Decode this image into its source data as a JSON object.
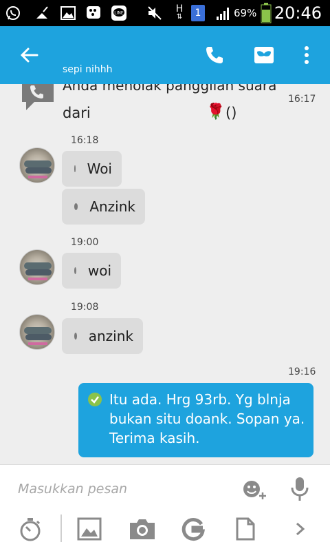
{
  "status_bar": {
    "battery_percent": "69%",
    "clock": "20:46",
    "sim_badge": "1",
    "network_label": "H",
    "icons": [
      "whatsapp-icon",
      "broom-icon",
      "gallery-icon",
      "bbm-icon",
      "line-icon",
      "mute-icon",
      "network-h-icon",
      "sim-icon",
      "signal-icon",
      "battery-icon"
    ]
  },
  "app_bar": {
    "subtitle": "sepi nihhh",
    "icons": [
      "back-arrow-icon",
      "phone-icon",
      "mask-icon",
      "overflow-menu-icon"
    ]
  },
  "messages": {
    "system": {
      "line1": "Anda menolak panggilan suara",
      "line2": "dari",
      "emoji": "🌹",
      "paren": "()",
      "time": "16:17"
    },
    "group1_time": "16:18",
    "msg1": "Woi",
    "msg2": "Anzink",
    "group2_time": "19:00",
    "msg3": "woi",
    "group3_time": "19:08",
    "msg4": "anzink",
    "out_time": "19:16",
    "out_msg": "Itu ada. Hrg 93rb. Yg blnja bukan situ doank. Sopan ya. Terima kasih."
  },
  "input": {
    "placeholder": "Masukkan pesan",
    "icons": [
      "emoji-add-icon",
      "mic-icon"
    ]
  },
  "toolbar": {
    "icons": [
      "timer-icon",
      "image-icon",
      "camera-icon",
      "google-icon",
      "document-icon",
      "chevron-right-icon"
    ]
  },
  "colors": {
    "accent": "#1ea3de",
    "bubble_in": "#dcdcdc",
    "check_green": "#8bc34a",
    "status_bar": "#000000"
  }
}
